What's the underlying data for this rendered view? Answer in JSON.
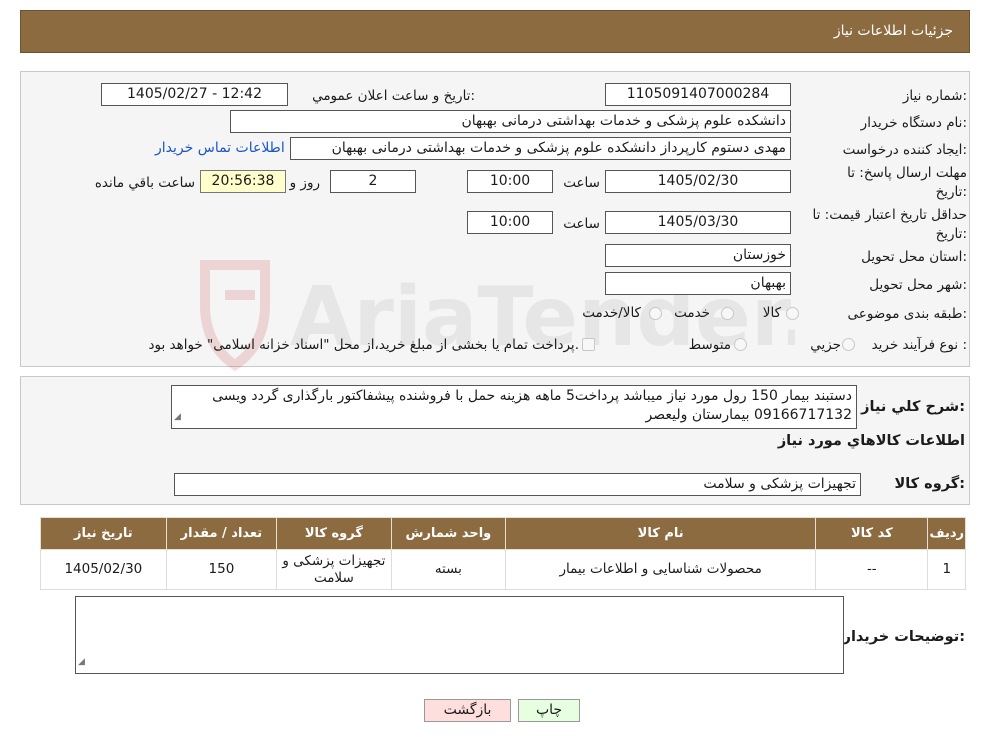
{
  "header": {
    "title": "جزئیات اطلاعات نیاز"
  },
  "fields": {
    "need_number_label": "شماره نیاز:",
    "need_number": "1105091407000284",
    "announce_label": "تاريخ و ساعت اعلان عمومي:",
    "announce_value": "1405/02/27 - 12:42",
    "buyer_org_label": "نام دستگاه خريدار:",
    "buyer_org": "دانشکده علوم پزشکی و خدمات بهداشتی  درمانی بهبهان",
    "creator_label": "ايجاد کننده درخواست:",
    "creator": "مهدی دستوم کارپرداز دانشکده علوم پزشکی و خدمات بهداشتی  درمانی بهبهان",
    "contact_link": "اطلاعات تماس خريدار",
    "deadline_label": "مهلت ارسال پاسخ: تا تاريخ:",
    "deadline_date": "1405/02/30",
    "time_label": "ساعت",
    "deadline_time": "10:00",
    "days_value": "2",
    "days_label": "روز و",
    "remaining_value": "20:56:38",
    "remaining_label": "ساعت باقي مانده",
    "validity_label": "حداقل تاريخ اعتبار قيمت: تا تاريخ:",
    "validity_date": "1405/03/30",
    "validity_time": "10:00",
    "province_label": "استان محل تحويل:",
    "province": "خوزستان",
    "city_label": "شهر محل تحويل:",
    "city": "بهبهان",
    "category_label": "طبقه بندی موضوعی:",
    "category_options": [
      "کالا",
      "خدمت",
      "کالا/خدمت"
    ],
    "process_label": "نوع فرآيند خريد :",
    "process_options": [
      "جزيي",
      "متوسط"
    ],
    "process_note": "پرداخت تمام يا بخشی از مبلغ خريد،از محل \"اسناد خزانه اسلامی\" خواهد بود."
  },
  "description": {
    "label": "شرح کلي نياز:",
    "text": "دستبند بیمار 150 رول مورد نیاز میباشد پرداخت5 ماهه هزینه حمل با فروشنده پیشفاکتور بارگذاری گردد ویسی 09166717132  بیمارستان ولیعصر"
  },
  "goods": {
    "section_title": "اطلاعات کالاهاي مورد نياز",
    "group_label": "گروه کالا:",
    "group_value": "تجهيزات پزشکی و سلامت",
    "columns": [
      "رديف",
      "کد کالا",
      "نام کالا",
      "واحد شمارش",
      "گروه کالا",
      "تعداد / مقدار",
      "تاريخ نياز"
    ],
    "rows": [
      [
        "1",
        "--",
        "محصولات شناسایی و اطلاعات بیمار",
        "بسته",
        "تجهيزات پزشکی و سلامت",
        "150",
        "1405/02/30"
      ]
    ]
  },
  "buyer_notes": {
    "label": "توضيحات خريدار:",
    "text": ""
  },
  "buttons": {
    "print": "چاپ",
    "back": "بازگشت"
  },
  "watermark_text": "AriaTender.neT",
  "colors": {
    "header_bg": "#8b6b3f",
    "link": "#1a55c8",
    "remaining_bg": "#ffffcc",
    "back_btn": "#ffdede",
    "print_btn": "#e7ffe0"
  }
}
